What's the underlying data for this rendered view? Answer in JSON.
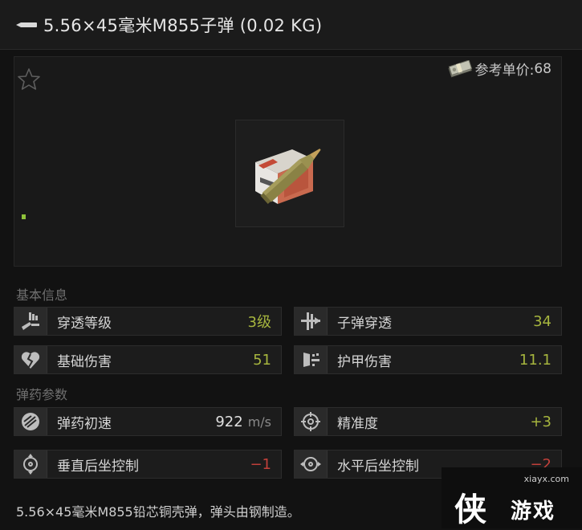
{
  "header": {
    "title": "5.56×45毫米M855子弹 (0.02 KG)",
    "title_icon": "bullet-icon"
  },
  "item_panel": {
    "favorite_icon": "star-outline-icon",
    "price_label": "参考单价:",
    "price_value": "68",
    "money_icon": "money-bundle-icon",
    "item_image": "ammo-box-with-cartridge"
  },
  "sections": {
    "basic_info": "基本信息",
    "ammo_params": "弹药参数"
  },
  "stats": {
    "penetration_level": {
      "label": "穿透等级",
      "value": "3级",
      "icon": "penetration-level-icon"
    },
    "bullet_penetration": {
      "label": "子弹穿透",
      "value": "34",
      "icon": "bullet-penetration-icon"
    },
    "base_damage": {
      "label": "基础伤害",
      "value": "51",
      "icon": "broken-heart-icon"
    },
    "armor_damage": {
      "label": "护甲伤害",
      "value": "11.1",
      "icon": "armor-damage-icon"
    },
    "muzzle_velocity": {
      "label": "弹药初速",
      "value": "922",
      "unit": "m/s",
      "icon": "velocity-icon"
    },
    "accuracy": {
      "label": "精准度",
      "value": "+3",
      "icon": "crosshair-icon"
    },
    "vertical_recoil": {
      "label": "垂直后坐控制",
      "value": "−1",
      "icon": "vertical-recoil-icon"
    },
    "horizontal_recoil": {
      "label": "水平后坐控制",
      "value": "−2",
      "icon": "horizontal-recoil-icon"
    }
  },
  "description": "5.56×45毫米M855铅芯铜壳弹，弹头由钢制造。",
  "watermark": {
    "url": "xiayx.com",
    "big": "侠",
    "small": "游戏"
  },
  "colors": {
    "positive": "#a6b53e",
    "negative": "#c2403a",
    "background": "#121212"
  }
}
